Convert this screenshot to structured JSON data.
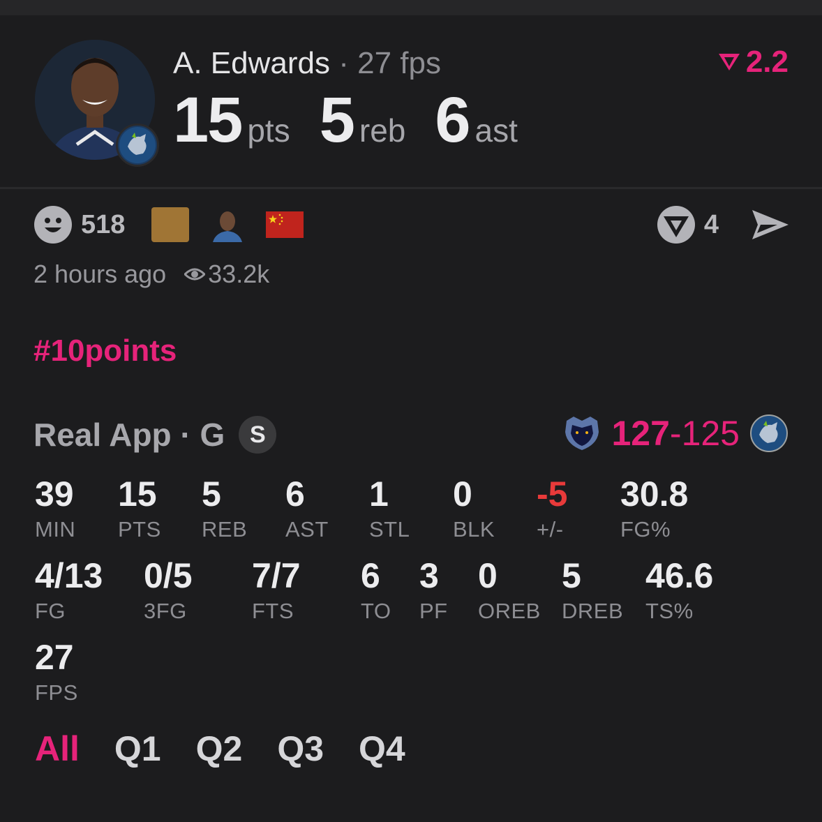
{
  "header": {
    "player_name": "A. Edwards",
    "separator": "·",
    "fps_label": "27 fps",
    "rating": "2.2",
    "stats": [
      {
        "value": "15",
        "unit": "pts"
      },
      {
        "value": "5",
        "unit": "reb"
      },
      {
        "value": "6",
        "unit": "ast"
      }
    ]
  },
  "social": {
    "reaction_count": "518",
    "vote_count": "4",
    "time_ago": "2 hours ago",
    "views": "33.2k"
  },
  "hashtag": "#10points",
  "source": {
    "label": "Real App · G",
    "badge": "S"
  },
  "score": {
    "home": "127",
    "dash": "-",
    "away": "125"
  },
  "stats_row1": [
    {
      "value": "39",
      "label": "MIN"
    },
    {
      "value": "15",
      "label": "PTS"
    },
    {
      "value": "5",
      "label": "REB"
    },
    {
      "value": "6",
      "label": "AST"
    },
    {
      "value": "1",
      "label": "STL"
    },
    {
      "value": "0",
      "label": "BLK"
    },
    {
      "value": "-5",
      "label": "+/-"
    },
    {
      "value": "30.8",
      "label": "FG%"
    }
  ],
  "stats_row2": [
    {
      "value": "4/13",
      "label": "FG"
    },
    {
      "value": "0/5",
      "label": "3FG"
    },
    {
      "value": "7/7",
      "label": "FTS"
    },
    {
      "value": "6",
      "label": "TO"
    },
    {
      "value": "3",
      "label": "PF"
    },
    {
      "value": "0",
      "label": "OREB"
    },
    {
      "value": "5",
      "label": "DREB"
    },
    {
      "value": "46.6",
      "label": "TS%"
    }
  ],
  "stats_row3": [
    {
      "value": "27",
      "label": "FPS"
    }
  ],
  "tabs": [
    "All",
    "Q1",
    "Q2",
    "Q3",
    "Q4"
  ],
  "colors": {
    "accent": "#e6237a",
    "negative": "#e83a3a",
    "background": "#1c1c1e"
  }
}
